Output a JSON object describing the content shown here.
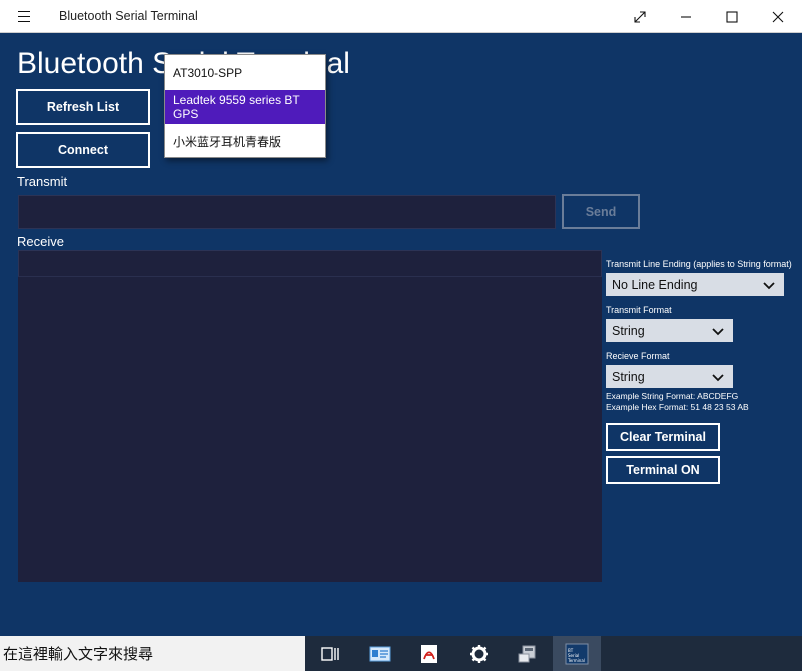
{
  "window": {
    "title": "Bluetooth Serial Terminal"
  },
  "header": {
    "page_title": "Bluetooth Serial Terminal"
  },
  "buttons": {
    "refresh": "Refresh List",
    "connect": "Connect",
    "send": "Send",
    "clear_terminal": "Clear Terminal",
    "terminal_toggle": "Terminal ON"
  },
  "transmit": {
    "label": "Transmit",
    "value": ""
  },
  "receive": {
    "label": "Receive"
  },
  "settings": {
    "line_ending_label": "Transmit Line Ending (applies to String format)",
    "line_ending_value": "No Line Ending",
    "transmit_format_label": "Transmit Format",
    "transmit_format_value": "String",
    "receive_format_label": "Recieve Format",
    "receive_format_value": "String",
    "example_string": "Example String Format: ABCDEFG",
    "example_hex": "Example Hex Format: 51 48 23 53 AB"
  },
  "device_dropdown": {
    "items": [
      {
        "label": "AT3010-SPP",
        "selected": false
      },
      {
        "label": "Leadtek 9559 series BT GPS",
        "selected": true
      },
      {
        "label": "小米蓝牙耳机青春版",
        "selected": false
      }
    ]
  },
  "taskbar": {
    "search_placeholder": "在這裡輸入文字來搜尋",
    "icons": [
      "task-view-icon",
      "contact-card-icon",
      "pdf-icon",
      "settings-gear-icon",
      "device-manager-icon",
      "serial-terminal-app-icon"
    ],
    "app_icon_text": "BT Serial Terminal"
  },
  "colors": {
    "background": "#0f3566",
    "terminal_bg": "#1e213d",
    "dropdown_selected": "#4f1bbb",
    "combo_bg": "#d8dde5",
    "disabled_border": "#6a7d99"
  }
}
